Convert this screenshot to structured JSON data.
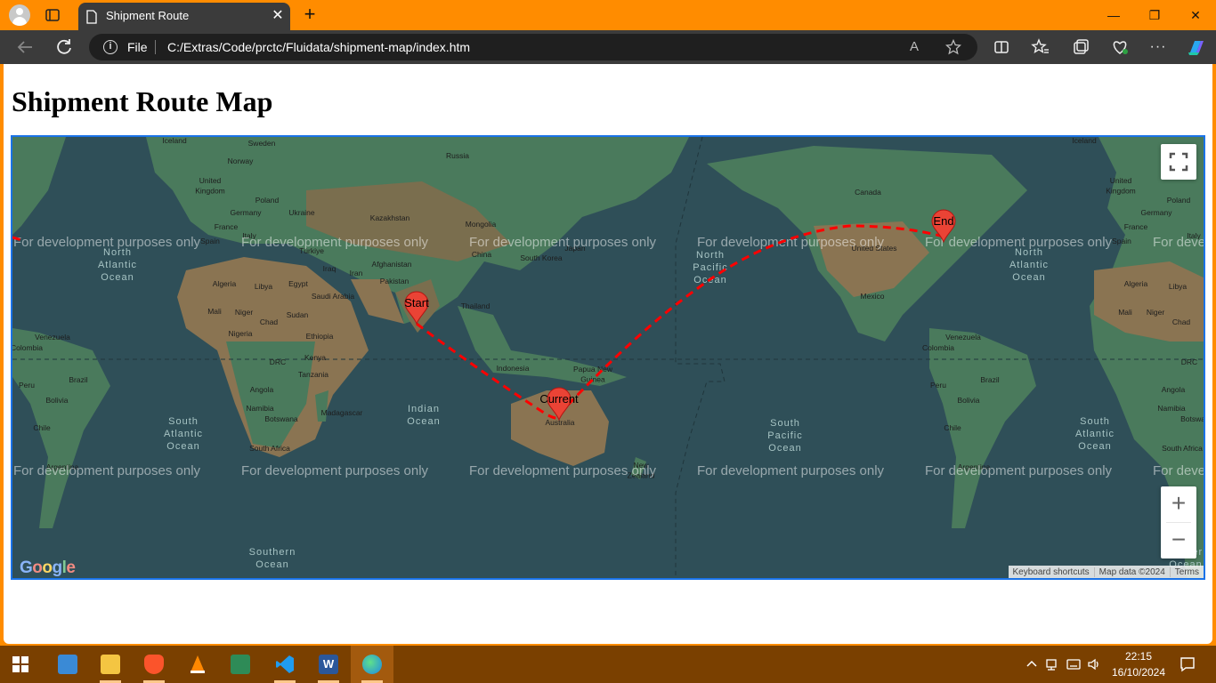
{
  "browser": {
    "tab_title": "Shipment Route",
    "close_tab_glyph": "✕",
    "new_tab_glyph": "+",
    "window_controls": {
      "minimize": "—",
      "maximize": "❐",
      "close": "✕"
    },
    "address_scheme": "File",
    "address_url": "C:/Extras/Code/prctc/Fluidata/shipment-map/index.htm",
    "read_aloud_glyph": "A",
    "toolbar_icons": [
      "back-icon",
      "refresh-icon",
      "read-aloud-icon",
      "favorite-star-icon",
      "split-screen-icon",
      "favorites-icon",
      "collections-icon",
      "browser-essentials-icon",
      "more-icon",
      "copilot-icon"
    ]
  },
  "page": {
    "heading": "Shipment Route Map"
  },
  "map": {
    "markers": [
      {
        "label": "Start"
      },
      {
        "label": "Current"
      },
      {
        "label": "End"
      }
    ],
    "watermark": "For development purposes only",
    "route_color": "#ff0000",
    "marker_color": "#ea4335",
    "place_labels": {
      "iceland_left": "Iceland",
      "sweden": "Sweden",
      "russia": "Russia",
      "norway": "Norway",
      "uk_left": "United\nKingdom",
      "poland_left": "Poland",
      "germany_left": "Germany",
      "ukraine": "Ukraine",
      "kazakhstan": "Kazakhstan",
      "mongolia": "Mongolia",
      "france_left": "France",
      "italy_left": "Italy",
      "spain_left": "Spain",
      "turkiye": "Türkiye",
      "china": "China",
      "south_korea": "South Korea",
      "japan": "Japan",
      "iraq": "Iraq",
      "iran": "Iran",
      "afghanistan": "Afghanistan",
      "pakistan": "Pakistan",
      "algeria_left": "Algeria",
      "libya_left": "Libya",
      "egypt": "Egypt",
      "saudi_arabia": "Saudi Arabia",
      "thailand": "Thailand",
      "mali_left": "Mali",
      "niger_left": "Niger",
      "chad_left": "Chad",
      "sudan": "Sudan",
      "nigeria": "Nigeria",
      "ethiopia": "Ethiopia",
      "venezuela_left": "Venezuela",
      "colombia_left": "Colombia",
      "drc_left": "DRC",
      "kenya": "Kenya",
      "indonesia": "Indonesia",
      "papua_new_guinea": "Papua New\nGuinea",
      "peru_left": "Peru",
      "brazil_left": "Brazil",
      "tanzania": "Tanzania",
      "angola_left": "Angola",
      "bolivia_left": "Bolivia",
      "namibia_left": "Namibia",
      "botswana_left": "Botswana",
      "madagascar": "Madagascar",
      "australia": "Australia",
      "chile_left": "Chile",
      "south_africa_left": "South Africa",
      "argentina_left": "Argentina",
      "new_zealand": "New\nZealand",
      "iceland_right": "Iceland",
      "canada": "Canada",
      "united_states": "United States",
      "mexico": "Mexico",
      "norway_right": "Norw",
      "uk_right": "United\nKingdom",
      "poland_right": "Poland",
      "germany_right": "Germany",
      "france_right": "France",
      "spain_right": "Spain",
      "italy_right": "Italy",
      "algeria_right": "Algeria",
      "libya_right": "Libya",
      "mali_right": "Mali",
      "niger_right": "Niger",
      "chad_right": "Chad",
      "venezuela_right": "Venezuela",
      "colombia_right": "Colombia",
      "drc_right": "DRC",
      "peru_right": "Peru",
      "brazil_right": "Brazil",
      "angola_right": "Angola",
      "bolivia_right": "Bolivia",
      "namibia_right": "Namibia",
      "botswana_right": "Botswa",
      "chile_right": "Chile",
      "south_africa_right": "South Africa",
      "argentina_right": "Argentina"
    },
    "ocean_labels": {
      "north_atlantic_left": "North\nAtlantic\nOcean",
      "north_pacific": "North\nPacific\nOcean",
      "north_atlantic_right": "North\nAtlantic\nOcean",
      "indian": "Indian\nOcean",
      "south_atlantic_left": "South\nAtlantic\nOcean",
      "south_pacific": "South\nPacific\nOcean",
      "south_atlantic_right": "South\nAtlantic\nOcean",
      "southern_left": "Southern\nOcean",
      "southern_right": "Southern\nOcean"
    },
    "controls": {
      "fullscreen_glyph": "⛶",
      "zoom_in": "+",
      "zoom_out": "−"
    },
    "attribution": {
      "keyboard_shortcuts": "Keyboard shortcuts",
      "map_data": "Map data ©2024",
      "terms": "Terms"
    },
    "logo": "Google",
    "colors": {
      "ocean": "#2f4f58",
      "land_green": "#4a7a5c",
      "land_desert": "#8a7452"
    }
  },
  "taskbar": {
    "apps": [
      {
        "name": "start-icon"
      },
      {
        "name": "control-panel-icon"
      },
      {
        "name": "file-explorer-icon"
      },
      {
        "name": "brave-icon"
      },
      {
        "name": "vlc-icon"
      },
      {
        "name": "chart-app-icon"
      },
      {
        "name": "vscode-icon"
      },
      {
        "name": "word-icon",
        "glyph": "W"
      },
      {
        "name": "edge-icon"
      }
    ],
    "time": "22:15",
    "date": "16/10/2024",
    "tray_icons": [
      "chevron-up-icon",
      "network-icon",
      "input-method-icon",
      "volume-icon",
      "notifications-icon"
    ]
  }
}
